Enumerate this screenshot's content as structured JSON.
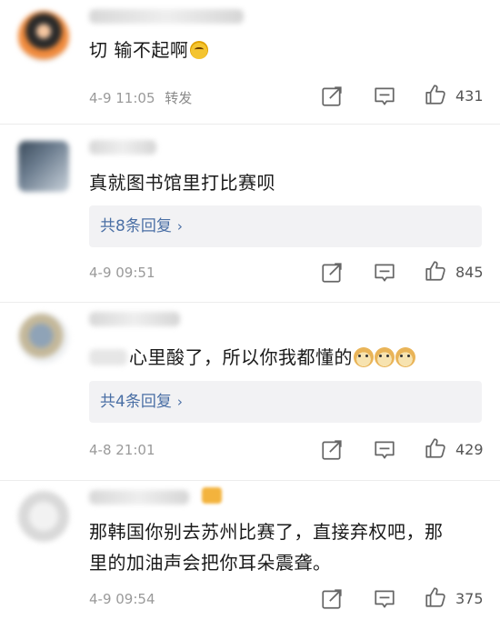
{
  "comments": [
    {
      "text": "切 输不起啊",
      "date": "4-9 11:05",
      "forward_label": "转发",
      "likes": "431",
      "replies_label": null
    },
    {
      "text": "真就图书馆里打比赛呗",
      "date": "4-9 09:51",
      "likes": "845",
      "replies_label": "共8条回复"
    },
    {
      "text": "心里酸了，所以你我都懂的",
      "date": "4-8 21:01",
      "likes": "429",
      "replies_label": "共4条回复"
    },
    {
      "text_line1": "那韩国你别去苏州比赛了，直接弃权吧，那",
      "text_line2": "里的加油声会把你耳朵震聋。",
      "date": "4-9 09:54",
      "likes": "375"
    }
  ],
  "icons": {
    "share": "share-icon",
    "comment": "comment-icon",
    "like": "thumbs-up-icon"
  },
  "colors": {
    "link_blue": "#4a6fa5",
    "meta_gray": "#9a9a9a",
    "reply_bg": "#f2f2f4"
  }
}
